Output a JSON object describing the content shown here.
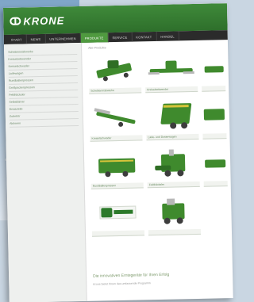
{
  "header": {
    "brand": "KRONE"
  },
  "nav": [
    {
      "label": "START"
    },
    {
      "label": "NEWS"
    },
    {
      "label": "UNTERNEHMEN"
    },
    {
      "label": "PRODUKTE"
    },
    {
      "label": "SERVICE"
    },
    {
      "label": "KONTAKT"
    },
    {
      "label": "HANDEL"
    }
  ],
  "active_nav": "PRODUKTE",
  "sidebar": [
    {
      "label": "Scheibenmähwerke"
    },
    {
      "label": "Kreiselzettwender"
    },
    {
      "label": "Kreiselschwader"
    },
    {
      "label": "Ladewagen"
    },
    {
      "label": "Rundballenpressen"
    },
    {
      "label": "Großpackenpressen"
    },
    {
      "label": "Feldhäcksler"
    },
    {
      "label": "Selbstfahrer"
    },
    {
      "label": "Ersatzteile"
    },
    {
      "label": "Zubehör"
    },
    {
      "label": "Aktionen"
    }
  ],
  "main": {
    "breadcrumb": "Alle Produkte",
    "products": [
      {
        "caption": "Scheibenmähwerke"
      },
      {
        "caption": "Kreiselzettwender"
      },
      {
        "caption": ""
      },
      {
        "caption": "Kreiselschwader"
      },
      {
        "caption": "Lade- und Dosierwagen"
      },
      {
        "caption": ""
      },
      {
        "caption": "Rundballenpressen"
      },
      {
        "caption": "Feldhäcksler"
      },
      {
        "caption": ""
      },
      {
        "caption": ""
      },
      {
        "caption": ""
      }
    ],
    "footer_title": "Die innovativen Erntegeräte für Ihren Erfolg",
    "footer_text": "Krone bietet Ihnen das umfassende Programm"
  },
  "colors": {
    "brand_green": "#3f8a3a",
    "nav_dark": "#2b2b2b",
    "active": "#4f9a3f"
  }
}
